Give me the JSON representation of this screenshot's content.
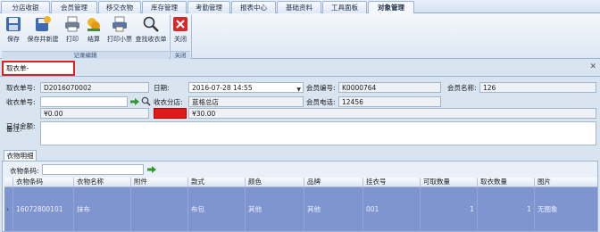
{
  "menu": {
    "tabs": [
      {
        "label": "分店收银"
      },
      {
        "label": "会员管理"
      },
      {
        "label": "移交衣物"
      },
      {
        "label": "库存管理"
      },
      {
        "label": "考勤管理"
      },
      {
        "label": "报表中心"
      },
      {
        "label": "基础资料"
      },
      {
        "label": "工具面板"
      },
      {
        "label": "对象管理"
      }
    ],
    "active": "对象管理"
  },
  "ribbon": {
    "buttons": [
      {
        "label": "保存",
        "icon": "save-icon"
      },
      {
        "label": "保存并新建",
        "icon": "save-new-icon"
      },
      {
        "label": "打印",
        "icon": "print-icon"
      },
      {
        "label": "结算",
        "icon": "settle-icon"
      },
      {
        "label": "打印小票",
        "icon": "print-receipt-icon"
      },
      {
        "label": "查找收衣单",
        "icon": "search-icon"
      },
      {
        "label": "关闭",
        "icon": "close-icon"
      }
    ],
    "groups": {
      "edit": "记录编辑",
      "close": "关闭"
    }
  },
  "doc_tab": {
    "label": "取衣单-D2016070002"
  },
  "form": {
    "order_no_label": "取衣单号:",
    "order_no": "D2016070002",
    "date_label": "日期:",
    "date": "2016-07-28 14:55",
    "member_no_label": "会员编号:",
    "member_no": "K0000764",
    "member_name_label": "会员名称:",
    "member_name": "126",
    "receipt_no_label": "收衣单号:",
    "receipt_no": "",
    "branch_label": "收衣分店:",
    "branch": "蓝格总店",
    "phone_label": "会员电话:",
    "phone": "12456",
    "paid_label": "已付金额:",
    "paid": "¥0.00",
    "unpaid_label": "未付金额:",
    "unpaid": "¥30.00",
    "remark_label": "备注:",
    "remark": ""
  },
  "detail": {
    "tab": "衣物明细",
    "barcode_label": "衣物条码:",
    "barcode": "",
    "columns": [
      "衣物条码",
      "衣物名称",
      "附件",
      "款式",
      "颜色",
      "品牌",
      "挂衣号",
      "可取数量",
      "取衣数量",
      "图片"
    ],
    "rows": [
      {
        "barcode": "16072800101",
        "name": "抹布",
        "attachment": "",
        "style": "布包",
        "color": "其他",
        "brand": "其他",
        "hanger": "001",
        "available_qty": "1",
        "take_qty": "1",
        "picture": "无图象"
      }
    ]
  },
  "colors": {
    "accent_red": "#e11b1b",
    "row_highlight": "#7f95cf",
    "frame_blue": "#9db4d2"
  }
}
